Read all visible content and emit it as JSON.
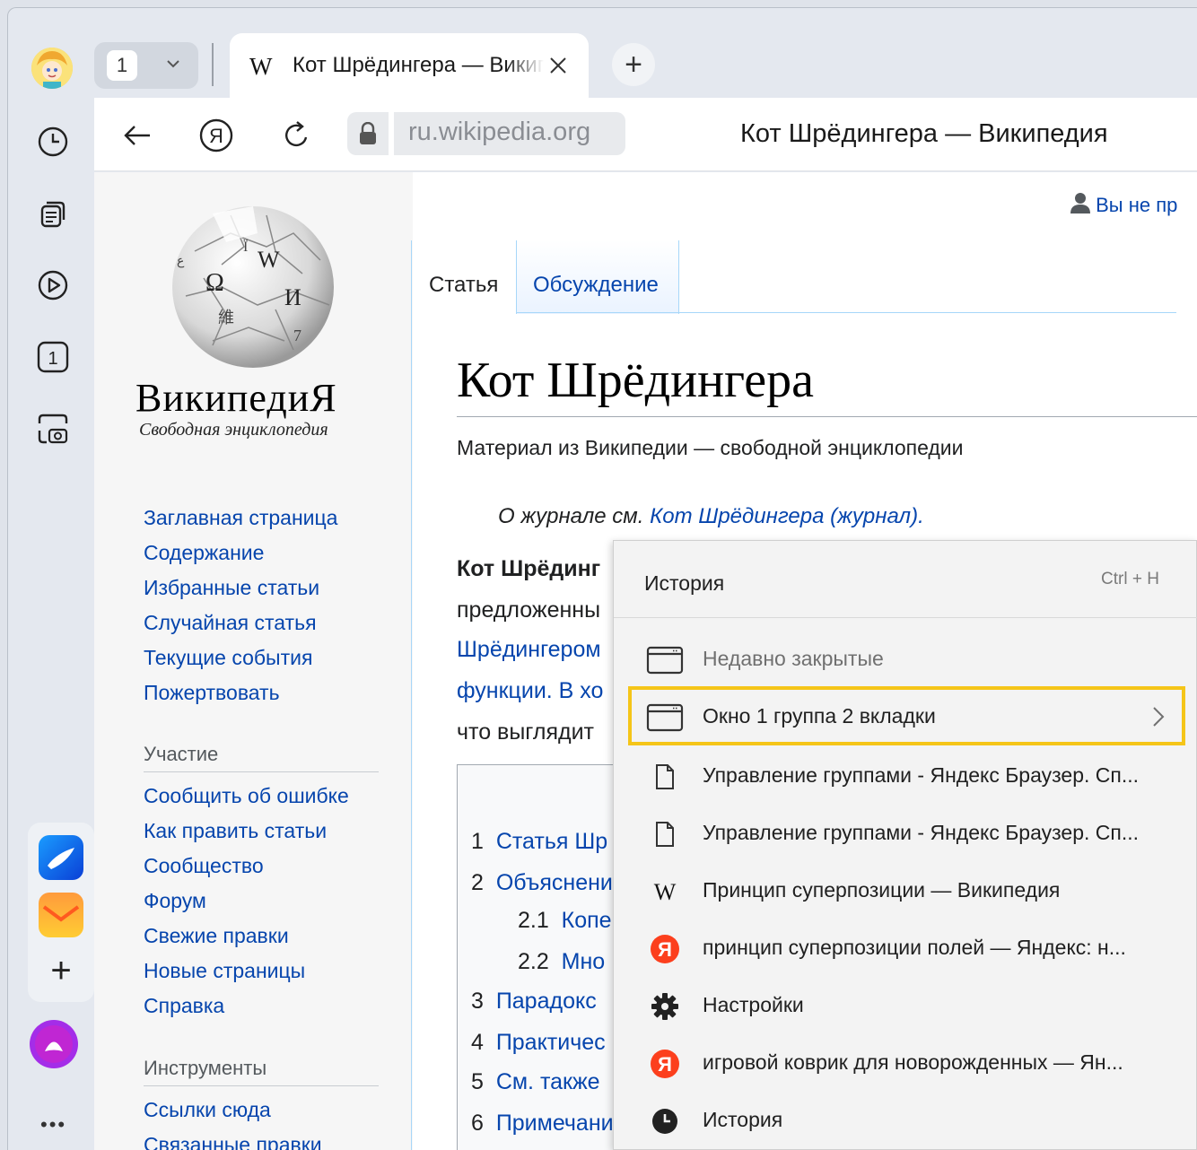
{
  "tab_strip": {
    "tab_count": "1",
    "active_tab_favicon": "W",
    "active_tab_title": "Кот Шрёдингера — Википедия",
    "new_tab_label": "+"
  },
  "address_bar": {
    "url": "ru.wikipedia.org",
    "page_title": "Кот Шрёдингера — Википедия"
  },
  "sidebar": {
    "icons": [
      "avatar",
      "history-icon",
      "collections-icon",
      "video-icon",
      "tab-counter-icon",
      "screenshot-icon",
      "messenger-app-icon",
      "mail-app-icon",
      "add-app-icon",
      "alice-icon",
      "more-icon"
    ],
    "screen_tab_count": "1"
  },
  "wiki": {
    "logo_word": "ВикипедиЯ",
    "logo_tagline": "Свободная энциклопедия",
    "user_line": "Вы не пр",
    "nav_main": [
      "Заглавная страница",
      "Содержание",
      "Избранные статьи",
      "Случайная статья",
      "Текущие события",
      "Пожертвовать"
    ],
    "nav_part_head": "Участие",
    "nav_part": [
      "Сообщить об ошибке",
      "Как править статьи",
      "Сообщество",
      "Форум",
      "Свежие правки",
      "Новые страницы",
      "Справка"
    ],
    "nav_tools_head": "Инструменты",
    "nav_tools": [
      "Ссылки сюда",
      "Связанные правки"
    ],
    "tab_article": "Статья",
    "tab_talk": "Обсуждение",
    "title": "Кот Шрёдингера",
    "subtitle": "Материал из Википедии — свободной энциклопедии",
    "hatnote_prefix": "О журнале см. ",
    "hatnote_link": "Кот Шрёдингера (журнал).",
    "para_lines": [
      "Кот Шрёдинг",
      "предложенны",
      "Шрёдингером",
      "функции. В хо",
      "что выглядит"
    ],
    "toc": [
      {
        "num": "1",
        "text": "Статья Шр"
      },
      {
        "num": "2",
        "text": "Объяснени"
      },
      {
        "num": "2.1",
        "text": "Копе"
      },
      {
        "num": "2.2",
        "text": "Мно"
      },
      {
        "num": "3",
        "text": "Парадокс"
      },
      {
        "num": "4",
        "text": "Практичес"
      },
      {
        "num": "5",
        "text": "См. также"
      },
      {
        "num": "6",
        "text": "Примечани"
      }
    ]
  },
  "history_menu": {
    "title": "История",
    "shortcut": "Ctrl + H",
    "items": [
      {
        "icon": "window-icon",
        "label": "Недавно закрытые",
        "dim": true,
        "arrow": false
      },
      {
        "icon": "window-icon",
        "label": "Окно 1 группа 2 вкладки",
        "dim": false,
        "arrow": true,
        "highlighted": true
      },
      {
        "icon": "document-icon",
        "label": "Управление группами - Яндекс Браузер. Сп...",
        "dim": false,
        "arrow": false
      },
      {
        "icon": "document-icon",
        "label": "Управление группами - Яндекс Браузер. Сп...",
        "dim": false,
        "arrow": false
      },
      {
        "icon": "wikipedia-icon",
        "label": "Принцип суперпозиции — Википедия",
        "dim": false,
        "arrow": false
      },
      {
        "icon": "yandex-icon",
        "label": "принцип суперпозиции полей — Яндекс: н...",
        "dim": false,
        "arrow": false
      },
      {
        "icon": "gear-icon",
        "label": "Настройки",
        "dim": false,
        "arrow": false
      },
      {
        "icon": "yandex-icon",
        "label": "игровой коврик для новорожденных — Ян...",
        "dim": false,
        "arrow": false
      },
      {
        "icon": "clock-icon",
        "label": "История",
        "dim": false,
        "arrow": false
      }
    ],
    "arrow_glyph": ">",
    "highlight_color": "#f5c518"
  },
  "colors": {
    "link": "#0645ad",
    "yandex_red": "#fc3f1d",
    "alice_purple": "#8a2be2"
  }
}
